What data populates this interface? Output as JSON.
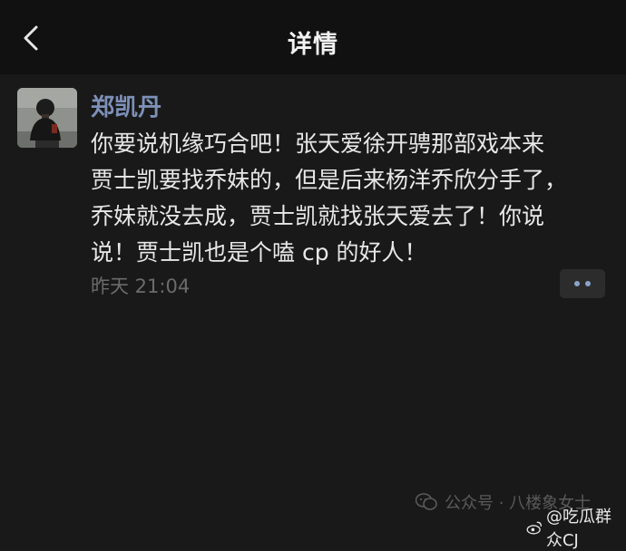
{
  "header": {
    "title": "详情",
    "back_icon": "chevron-left-icon"
  },
  "post": {
    "author": "郑凯丹",
    "body": "你要说机缘巧合吧！张天爱徐开骋那部戏本来\n贾士凯要找乔妹的，但是后来杨洋乔欣分手了，\n乔妹就没去成，贾士凯就找张天爱去了！你说\n说！贾士凯也是个嗑 cp 的好人！",
    "time": "昨天 21:04",
    "more_icon": "more-dots-icon"
  },
  "watermark": {
    "official_account": "公众号 · 八楼象女士",
    "weibo_account": "@吃瓜群众CJ"
  },
  "colors": {
    "background": "#191919",
    "header": "#111111",
    "author_name": "#7d90b8",
    "time": "#6b6b6b"
  }
}
